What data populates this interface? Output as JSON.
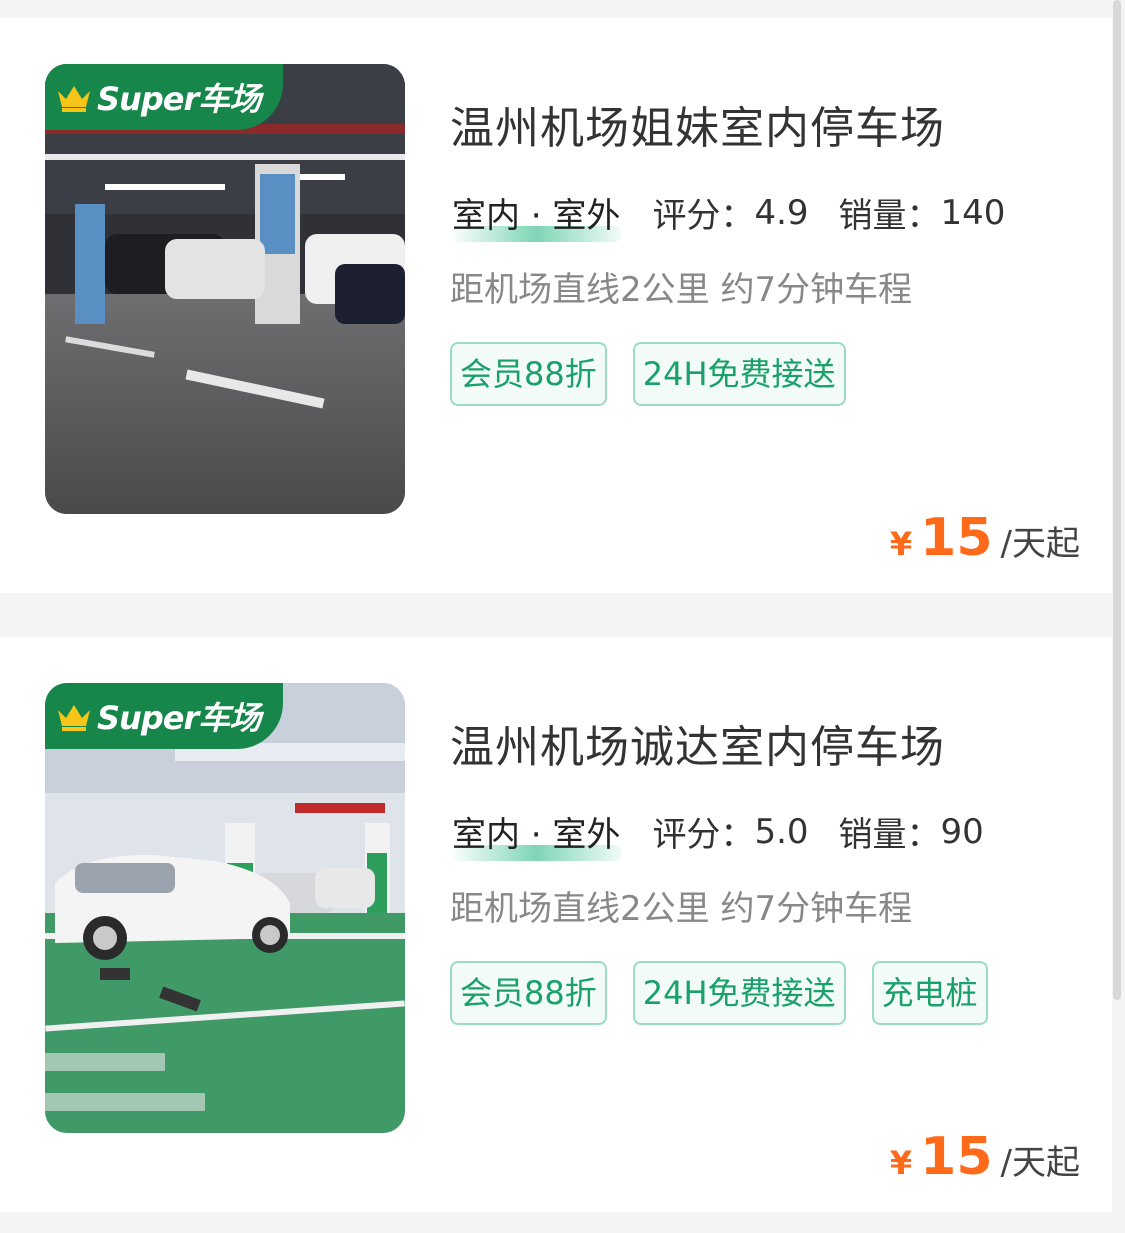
{
  "badge": {
    "text": "Super车场",
    "icon": "crown-icon"
  },
  "listings": [
    {
      "title": "温州机场姐妹室内停车场",
      "type": "室内 · 室外",
      "score_label": "评分：",
      "score": "4.9",
      "sales_label": "销量：",
      "sales": "140",
      "distance": "距机场直线2公里 约7分钟车程",
      "tags": [
        "会员88折",
        "24H免费接送"
      ],
      "currency": "¥",
      "price": "15",
      "unit": "/天起"
    },
    {
      "title": "温州机场诚达室内停车场",
      "type": "室内 · 室外",
      "score_label": "评分：",
      "score": "5.0",
      "sales_label": "销量：",
      "sales": "90",
      "distance": "距机场直线2公里 约7分钟车程",
      "tags": [
        "会员88折",
        "24H免费接送",
        "充电桩"
      ],
      "currency": "¥",
      "price": "15",
      "unit": "/天起"
    }
  ],
  "colors": {
    "badge_green": "#17864a",
    "tag_green": "#1aa06a",
    "price_orange": "#ff6a1a"
  }
}
